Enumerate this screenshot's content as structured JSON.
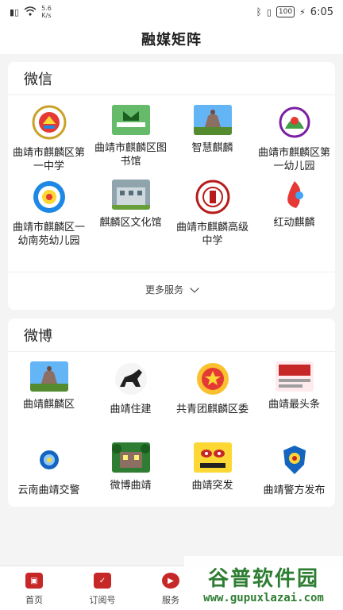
{
  "status": {
    "speed_value": "5.6",
    "speed_unit": "K/s",
    "battery": "100",
    "time": "6:05"
  },
  "header": {
    "title": "融媒矩阵"
  },
  "wechat": {
    "title": "微信",
    "items": [
      {
        "label": "曲靖市麒麟区第一中学",
        "icon": "school-emblem-icon"
      },
      {
        "label": "曲靖市麒麟区图书馆",
        "icon": "library-logo-icon"
      },
      {
        "label": "智慧麒麟",
        "icon": "qilin-statue-icon"
      },
      {
        "label": "曲靖市麒麟区第一幼儿园",
        "icon": "kindergarten-logo-icon"
      },
      {
        "label": "曲靖市麒麟区一幼南苑幼儿园",
        "icon": "kindergarten-emblem-icon"
      },
      {
        "label": "麒麟区文化馆",
        "icon": "culture-hall-building-icon"
      },
      {
        "label": "曲靖市麒麟高级中学",
        "icon": "high-school-seal-icon"
      },
      {
        "label": "红动麒麟",
        "icon": "red-flame-logo-icon"
      }
    ],
    "more_label": "更多服务"
  },
  "weibo": {
    "title": "微博",
    "items": [
      {
        "label": "曲靖麒麟区",
        "icon": "qilin-statue-icon"
      },
      {
        "label": "曲靖住建",
        "icon": "horse-rider-logo-icon"
      },
      {
        "label": "共青团麒麟区委",
        "icon": "youth-league-badge-icon"
      },
      {
        "label": "曲靖最头条",
        "icon": "headline-news-logo-icon"
      },
      {
        "label": "云南曲靖交警",
        "icon": "traffic-police-badge-icon"
      },
      {
        "label": "微博曲靖",
        "icon": "city-photo-icon"
      },
      {
        "label": "曲靖突发",
        "icon": "breaking-news-logo-icon"
      },
      {
        "label": "曲靖警方发布",
        "icon": "police-badge-icon"
      }
    ]
  },
  "tabs": [
    {
      "label": "首页"
    },
    {
      "label": "订阅号"
    },
    {
      "label": "服务"
    }
  ],
  "watermark": {
    "main": "谷普软件园",
    "url": "www.gupuxlazai.com"
  },
  "colors": {
    "accent": "#c62828",
    "watermark": "#2e7d32"
  }
}
